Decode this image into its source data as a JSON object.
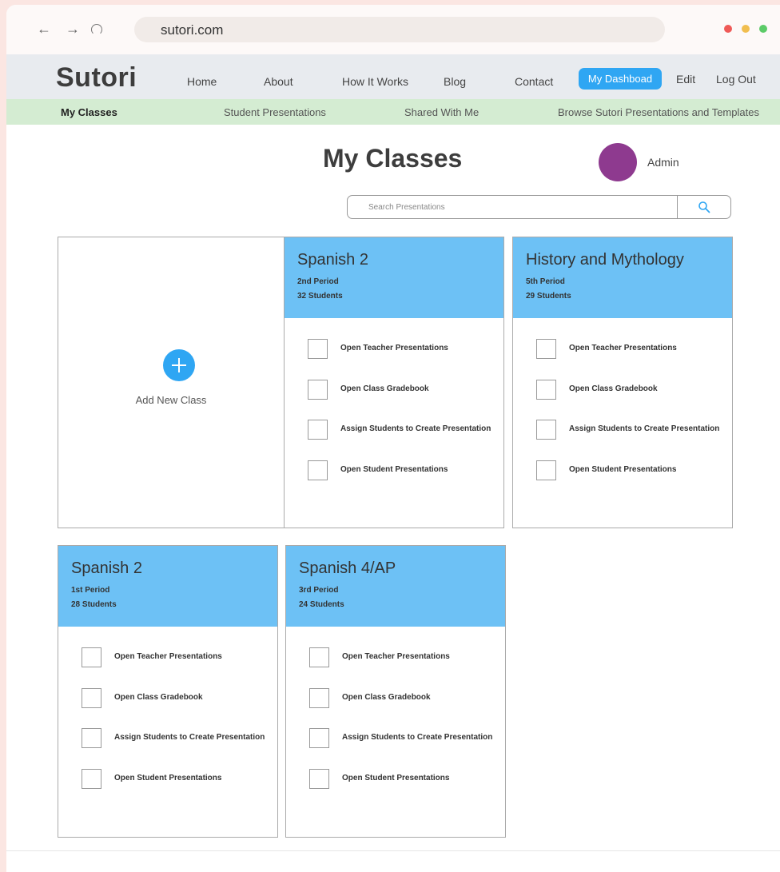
{
  "browser": {
    "url": "sutori.com",
    "colors": {
      "close": "#ef5a57",
      "minimize": "#f1be4f",
      "maximize": "#5ccb68"
    }
  },
  "header": {
    "logo": "Sutori",
    "menu": [
      "Home",
      "About",
      "How It Works",
      "Blog",
      "Contact"
    ],
    "dashboard_label": "My Dashboad",
    "edit_label": "Edit",
    "logout_label": "Log Out",
    "accent_color": "#2fa6f3"
  },
  "subnav": {
    "items": [
      "My Classes",
      "Student Presentations",
      "Shared With Me",
      "Browse Sutori Presentations and Templates"
    ],
    "active": "My Classes"
  },
  "main": {
    "title": "My Classes",
    "user": {
      "name": "Admin",
      "avatar_color": "#8e3a8f"
    },
    "search": {
      "placeholder": "Search Presentations",
      "icon": "search-icon"
    },
    "add_class": {
      "label": "Add New Class",
      "icon": "plus-circle-icon"
    },
    "actions": [
      "Open Teacher Presentations",
      "Open Class Gradebook",
      "Assign Students to Create Presentation",
      "Open Student Presentations"
    ],
    "classes": [
      {
        "name": "Spanish 2",
        "period": "2nd Period",
        "students": "32 Students"
      },
      {
        "name": "History and Mythology",
        "period": "5th Period",
        "students": "29 Students"
      },
      {
        "name": "Spanish 2",
        "period": "1st Period",
        "students": "28 Students"
      },
      {
        "name": "Spanish 4/AP",
        "period": "3rd Period",
        "students": "24 Students"
      }
    ],
    "card_header_color": "#6dc1f5"
  }
}
